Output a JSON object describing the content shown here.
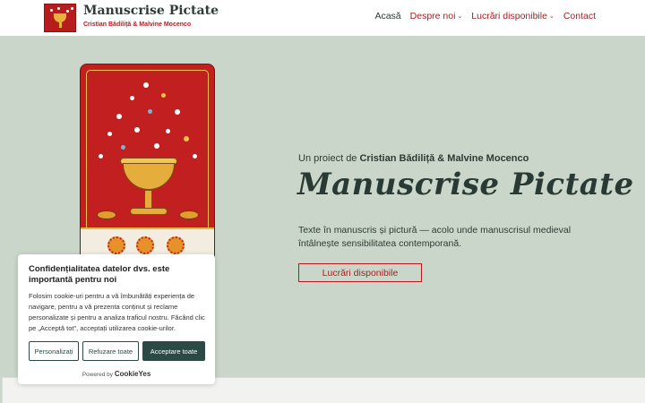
{
  "header": {
    "site_title": "Manuscrise Pictate",
    "site_tagline": "Cristian Bădiliță & Malvine Mocenco",
    "logo_icon": "manuscript-goblet-logo"
  },
  "nav": {
    "items": [
      {
        "label": "Acasă",
        "has_dropdown": false,
        "active": true
      },
      {
        "label": "Despre noi",
        "has_dropdown": true,
        "active": false
      },
      {
        "label": "Lucrări disponibile",
        "has_dropdown": true,
        "active": false
      },
      {
        "label": "Contact",
        "has_dropdown": false,
        "active": false
      }
    ],
    "chevron": "⌄"
  },
  "hero": {
    "pre_prefix": "Un proiect de ",
    "pre_authors": "Cristian Bădiliță & Malvine Mocenco",
    "title": "Manuscrise Pictate",
    "description": "Texte în manuscris și pictură — acolo unde manuscrisul medieval întâlnește sensibilitatea contemporană.",
    "button_label": "Lucrări disponibile",
    "image": "illuminated-manuscript-painting"
  },
  "cookie": {
    "title": "Confidențialitatea datelor dvs. este importantă pentru noi",
    "text": "Folosim cookie-uri pentru a vă îmbunătăți experiența de navigare, pentru a vă prezenta conținut și reclame personalizate și pentru a analiza traficul nostru. Făcând clic pe „Acceptă tot\", acceptați utilizarea cookie-urilor.",
    "customize_label": "Personalizați",
    "reject_label": "Refuzare toate",
    "accept_label": "Acceptare toate",
    "powered_prefix": "Powered by",
    "powered_brand": "CookieYes"
  },
  "colors": {
    "background": "#c9d6c9",
    "accent_red": "#b4191f",
    "dark_green": "#2c4a45",
    "text_dark": "#2d3b35"
  }
}
